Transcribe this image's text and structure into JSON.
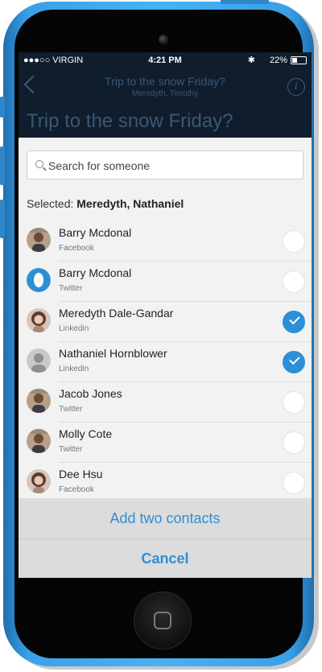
{
  "status_bar": {
    "carrier": "●●●○○ VIRGIN",
    "time": "4:21 PM",
    "battery": "22%"
  },
  "nav": {
    "title": "Trip to the snow Friday?",
    "subtitle": "Meredyth, Timothy",
    "big_title": "Trip to the snow Friday?",
    "info_glyph": "i"
  },
  "search": {
    "placeholder": "Search for someone"
  },
  "selected": {
    "label": "Selected:",
    "names": "Meredyth, Nathaniel"
  },
  "contacts": [
    {
      "name": "Barry Mcdonal",
      "source": "Facebook",
      "checked": false,
      "avatar_icon": "photo-man-avatar"
    },
    {
      "name": "Barry Mcdonal",
      "source": "Twitter",
      "checked": false,
      "avatar_icon": "blue-ring-avatar"
    },
    {
      "name": "Meredyth Dale-Gandar",
      "source": "Linkedin",
      "checked": true,
      "avatar_icon": "photo-woman-avatar"
    },
    {
      "name": "Nathaniel Hornblower",
      "source": "Linkedin",
      "checked": true,
      "avatar_icon": "silhouette-avatar"
    },
    {
      "name": "Jacob Jones",
      "source": "Twitter",
      "checked": false,
      "avatar_icon": "photo-man-avatar"
    },
    {
      "name": "Molly Cote",
      "source": "Twitter",
      "checked": false,
      "avatar_icon": "photo-man-avatar"
    },
    {
      "name": "Dee Hsu",
      "source": "Facebook",
      "checked": false,
      "avatar_icon": "photo-woman-avatar"
    }
  ],
  "actions": {
    "add": "Add two contacts",
    "cancel": "Cancel"
  },
  "colors": {
    "accent": "#2d8fd6",
    "nav_background": "#0f1d2d",
    "phone_body": "#48b2f2"
  }
}
